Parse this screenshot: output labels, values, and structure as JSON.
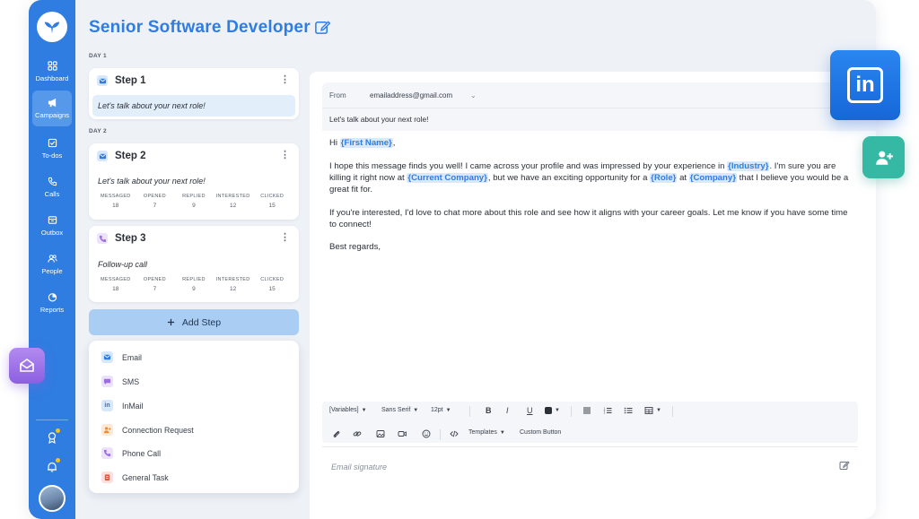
{
  "colors": {
    "brand": "#2f7de1",
    "linkedin": "#1f74e6",
    "green": "#35b8a4",
    "purple": "#9b6ee6"
  },
  "sidebar": {
    "items": [
      {
        "label": "Dashboard",
        "icon": "grid-icon"
      },
      {
        "label": "Campaigns",
        "icon": "megaphone-icon",
        "active": true
      },
      {
        "label": "To-dos",
        "icon": "checkbox-icon"
      },
      {
        "label": "Calls",
        "icon": "phone-icon"
      },
      {
        "label": "Outbox",
        "icon": "inbox-icon"
      },
      {
        "label": "People",
        "icon": "people-icon"
      },
      {
        "label": "Reports",
        "icon": "pie-chart-icon"
      }
    ]
  },
  "header": {
    "title": "Senior Software Developer"
  },
  "days": {
    "day1": "DAY 1",
    "day2": "DAY 2"
  },
  "steps": [
    {
      "name": "Step 1",
      "subtitle": "Let's talk about your next role!",
      "icon": "email-icon"
    },
    {
      "name": "Step 2",
      "subtitle": "Let's talk about your next role!",
      "icon": "email-icon",
      "stats": [
        {
          "label": "MESSAGED",
          "value": "18"
        },
        {
          "label": "OPENED",
          "value": "7"
        },
        {
          "label": "REPLIED",
          "value": "9"
        },
        {
          "label": "INTERESTED",
          "value": "12"
        },
        {
          "label": "CLICKED",
          "value": "15"
        }
      ]
    },
    {
      "name": "Step 3",
      "subtitle": "Follow-up call",
      "icon": "phone-icon",
      "stats": [
        {
          "label": "MESSAGED",
          "value": "18"
        },
        {
          "label": "OPENED",
          "value": "7"
        },
        {
          "label": "REPLIED",
          "value": "9"
        },
        {
          "label": "INTERESTED",
          "value": "12"
        },
        {
          "label": "CLICKED",
          "value": "15"
        }
      ]
    }
  ],
  "add_step": {
    "label": "Add Step"
  },
  "step_menu": {
    "items": [
      {
        "label": "Email",
        "icon": "email-icon"
      },
      {
        "label": "SMS",
        "icon": "chat-icon"
      },
      {
        "label": "InMail",
        "icon": "linkedin-icon"
      },
      {
        "label": "Connection Request",
        "icon": "add-person-icon"
      },
      {
        "label": "Phone Call",
        "icon": "phone-icon"
      },
      {
        "label": "General Task",
        "icon": "task-icon"
      }
    ]
  },
  "email": {
    "from_label": "From",
    "from_value": "emailaddress@gmail.com",
    "subject": "Let's talk about your next role!",
    "greeting": "Hi",
    "greeting_var": "{First Name}",
    "greeting_end": ",",
    "p1_a": "I hope this message finds you well! I came across your profile and was impressed by your experience in ",
    "p1_var1": "{Industry}",
    "p1_b": ". I'm sure you are killing it right now at ",
    "p1_var2": "{Current Company}",
    "p1_c": ", but we have an exciting opportunity for a ",
    "p1_var3": "{Role}",
    "p1_d": " at ",
    "p1_var4": "{Company}",
    "p1_e": " that I believe you would be a great fit for.",
    "p2": "If you're interested, I'd love to chat more about this role and see how it aligns with your career goals. Let me know if you have some time to connect!",
    "signoff": "Best regards,",
    "signature_placeholder": "Email signature"
  },
  "toolbar": {
    "variables": "[Variables]",
    "font": "Sans Serif",
    "size": "12pt",
    "bold": "B",
    "italic": "I",
    "underline": "U",
    "templates": "Templates",
    "custom_button": "Custom Button"
  }
}
